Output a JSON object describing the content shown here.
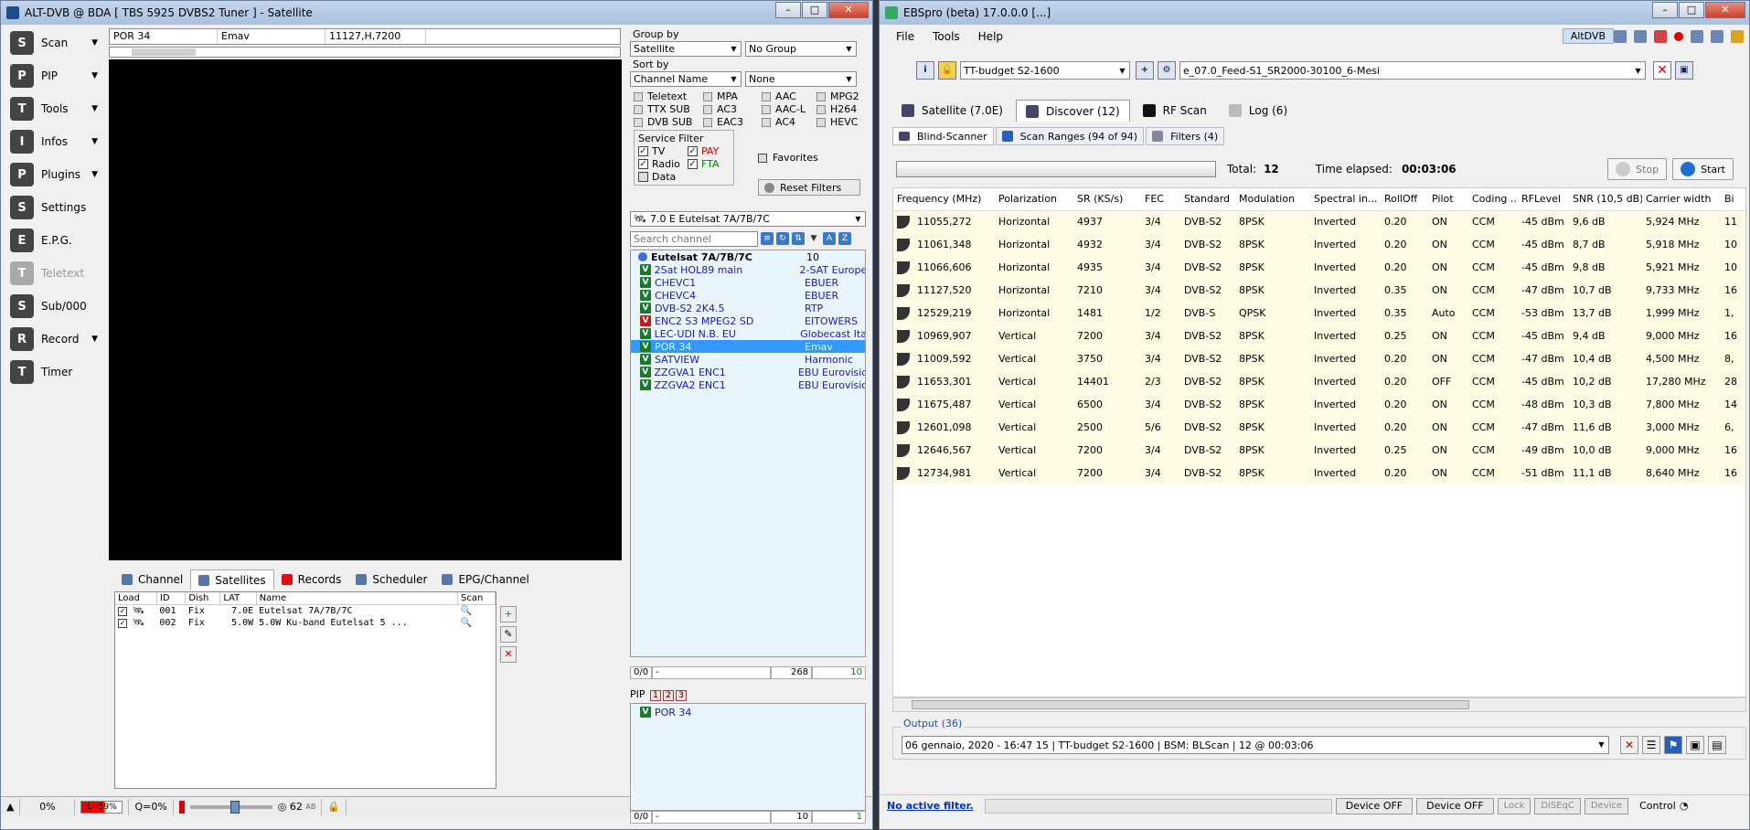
{
  "alt": {
    "title": "ALT-DVB @ BDA [ TBS 5925 DVBS2 Tuner ] - Satellite",
    "toolbar": [
      {
        "label": "Scan",
        "icon": "satellite-dish-icon",
        "arrow": true
      },
      {
        "label": "PIP",
        "icon": "pip-icon",
        "arrow": true
      },
      {
        "label": "Tools",
        "icon": "tools-icon",
        "arrow": true
      },
      {
        "label": "Infos",
        "icon": "info-icon",
        "arrow": true
      },
      {
        "label": "Plugins",
        "icon": "plugin-icon",
        "arrow": true
      },
      {
        "label": "Settings",
        "icon": "gear-icon",
        "arrow": false
      },
      {
        "label": "E.P.G.",
        "icon": "epg-icon",
        "arrow": false
      },
      {
        "label": "Teletext",
        "icon": "teletext-icon",
        "arrow": false,
        "disabled": true
      },
      {
        "label": "Sub/000",
        "icon": "sub-icon",
        "arrow": false
      },
      {
        "label": "Record",
        "icon": "record-icon",
        "arrow": true
      },
      {
        "label": "Timer",
        "icon": "clock-icon",
        "arrow": false
      }
    ],
    "info": {
      "channel": "POR 34",
      "provider": "Emav",
      "tp": "11127,H,7200"
    },
    "tabs": [
      "Channel",
      "Satellites",
      "Records",
      "Scheduler",
      "EPG/Channel"
    ],
    "sat_headers": [
      "Load",
      "ID",
      "Dish",
      "LAT",
      "Name",
      "Scan"
    ],
    "sat_rows": [
      {
        "id": "001",
        "dish": "Fix",
        "lat": "7.0E",
        "name": "Eutelsat 7A/7B/7C"
      },
      {
        "id": "002",
        "dish": "Fix",
        "lat": "5.0W",
        "name": "5.0W Ku-band Eutelsat 5 ..."
      }
    ],
    "status": {
      "pct": "0%",
      "level": "L=59%",
      "quality": "Q=0%",
      "volume": "62",
      "ab": "AB",
      "zoom0": "0",
      "zoom1": "1",
      "zoom2": "2",
      "zoom3": "3"
    },
    "group_by_label": "Group by",
    "group_by": "Satellite",
    "group_by2": "No Group",
    "sort_by_label": "Sort by",
    "sort_by": "Channel Name",
    "sort_by2": "None",
    "filters": [
      "Teletext",
      "MPA",
      "AAC",
      "MPG2",
      "TTX SUB",
      "AC3",
      "AAC-L",
      "H264",
      "DVB SUB",
      "EAC3",
      "AC4",
      "HEVC"
    ],
    "service_filter_label": "Service Filter",
    "svc": {
      "tv": "TV",
      "pay": "PAY",
      "radio": "Radio",
      "fta": "FTA",
      "data": "Data"
    },
    "favorites": "Favorites",
    "reset_filters": "Reset Filters",
    "sat_select": "7.0 E Eutelsat 7A/7B/7C",
    "search_placeholder": "Search channel",
    "group_name": "Eutelsat 7A/7B/7C",
    "group_count": "10",
    "channels": [
      {
        "name": "2Sat HOL89 main",
        "prov": "2-SAT Europe",
        "red": false
      },
      {
        "name": "CHEVC1",
        "prov": "EBUER",
        "red": false
      },
      {
        "name": "CHEVC4",
        "prov": "EBUER",
        "red": false
      },
      {
        "name": "DVB-S2 2K4.5",
        "prov": "RTP",
        "red": false
      },
      {
        "name": "ENC2 S3 MPEG2 SD",
        "prov": "EITOWERS",
        "red": true
      },
      {
        "name": "LEC-UDI N.B. EU",
        "prov": "Globecast Ita",
        "red": false
      },
      {
        "name": "POR 34",
        "prov": "Emav",
        "red": false,
        "selected": true
      },
      {
        "name": "SATVIEW",
        "prov": "Harmonic",
        "red": false
      },
      {
        "name": "ZZGVA1 ENC1",
        "prov": "EBU Eurovisio",
        "red": false
      },
      {
        "name": "ZZGVA2 ENC1",
        "prov": "EBU Eurovisio",
        "red": false
      }
    ],
    "list_foot": {
      "pos": "0/0",
      "dash": "-",
      "total": "268",
      "count": "10"
    },
    "pip_label": "PIP",
    "pip_channel": "POR 34",
    "pip_foot": {
      "pos": "0/0",
      "dash": "-",
      "total": "10",
      "count": "1"
    }
  },
  "ebs": {
    "title": "EBSpro (beta) 17.0.0.0 [...]",
    "menu": [
      "File",
      "Tools",
      "Help"
    ],
    "altdvb": "AltDVB",
    "device": "TT-budget S2-1600",
    "preset": "e_07.0_Feed-S1_SR2000-30100_6-Mesi",
    "tabs": [
      "Satellite (7.0E)",
      "Discover (12)",
      "RF Scan",
      "Log (6)"
    ],
    "subtabs": [
      "Blind-Scanner",
      "Scan Ranges (94 of 94)",
      "Filters (4)"
    ],
    "total_label": "Total:",
    "total": "12",
    "elapsed_label": "Time elapsed:",
    "elapsed": "00:03:06",
    "stop": "Stop",
    "start": "Start",
    "headers": [
      "Frequency (MHz)",
      "Polarization",
      "SR (KS/s)",
      "FEC",
      "Standard",
      "Modulation",
      "Spectral in...",
      "RollOff",
      "Pilot",
      "Coding ...",
      "RFLevel",
      "SNR (10,5 dB)",
      "Carrier width",
      "Bi"
    ],
    "rows": [
      [
        "11055,272",
        "Horizontal",
        "4937",
        "3/4",
        "DVB-S2",
        "8PSK",
        "Inverted",
        "0.20",
        "ON",
        "CCM",
        "-45 dBm",
        "9,6 dB",
        "5,924 MHz",
        "11"
      ],
      [
        "11061,348",
        "Horizontal",
        "4932",
        "3/4",
        "DVB-S2",
        "8PSK",
        "Inverted",
        "0.20",
        "ON",
        "CCM",
        "-45 dBm",
        "8,7 dB",
        "5,918 MHz",
        "10"
      ],
      [
        "11066,606",
        "Horizontal",
        "4935",
        "3/4",
        "DVB-S2",
        "8PSK",
        "Inverted",
        "0.20",
        "ON",
        "CCM",
        "-45 dBm",
        "9,8 dB",
        "5,921 MHz",
        "10"
      ],
      [
        "11127,520",
        "Horizontal",
        "7210",
        "3/4",
        "DVB-S2",
        "8PSK",
        "Inverted",
        "0.35",
        "ON",
        "CCM",
        "-47 dBm",
        "10,7 dB",
        "9,733 MHz",
        "16"
      ],
      [
        "12529,219",
        "Horizontal",
        "1481",
        "1/2",
        "DVB-S",
        "QPSK",
        "Inverted",
        "0.35",
        "Auto",
        "CCM",
        "-53 dBm",
        "13,7 dB",
        "1,999 MHz",
        "1,"
      ],
      [
        "10969,907",
        "Vertical",
        "7200",
        "3/4",
        "DVB-S2",
        "8PSK",
        "Inverted",
        "0.25",
        "ON",
        "CCM",
        "-45 dBm",
        "9,4 dB",
        "9,000 MHz",
        "16"
      ],
      [
        "11009,592",
        "Vertical",
        "3750",
        "3/4",
        "DVB-S2",
        "8PSK",
        "Inverted",
        "0.20",
        "ON",
        "CCM",
        "-47 dBm",
        "10,4 dB",
        "4,500 MHz",
        "8,"
      ],
      [
        "11653,301",
        "Vertical",
        "14401",
        "2/3",
        "DVB-S2",
        "8PSK",
        "Inverted",
        "0.20",
        "OFF",
        "CCM",
        "-45 dBm",
        "10,2 dB",
        "17,280 MHz",
        "28"
      ],
      [
        "11675,487",
        "Vertical",
        "6500",
        "3/4",
        "DVB-S2",
        "8PSK",
        "Inverted",
        "0.20",
        "ON",
        "CCM",
        "-48 dBm",
        "10,3 dB",
        "7,800 MHz",
        "14"
      ],
      [
        "12601,098",
        "Vertical",
        "2500",
        "5/6",
        "DVB-S2",
        "8PSK",
        "Inverted",
        "0.20",
        "ON",
        "CCM",
        "-47 dBm",
        "11,6 dB",
        "3,000 MHz",
        "6,"
      ],
      [
        "12646,567",
        "Vertical",
        "7200",
        "3/4",
        "DVB-S2",
        "8PSK",
        "Inverted",
        "0.25",
        "ON",
        "CCM",
        "-49 dBm",
        "10,0 dB",
        "9,000 MHz",
        "16"
      ],
      [
        "12734,981",
        "Vertical",
        "7200",
        "3/4",
        "DVB-S2",
        "8PSK",
        "Inverted",
        "0.20",
        "ON",
        "CCM",
        "-51 dBm",
        "11,1 dB",
        "8,640 MHz",
        "16"
      ]
    ],
    "output_label": "Output (36)",
    "output": "06 gennaio, 2020 - 16:47 15 | TT-budget S2-1600 | BSM: BLScan | 12 @ 00:03:06",
    "status": {
      "noact": "No active filter.",
      "dev1": "Device OFF",
      "dev2": "Device OFF",
      "lock": "Lock",
      "diseqc": "DiSEqC",
      "device": "Device",
      "control": "Control"
    }
  }
}
